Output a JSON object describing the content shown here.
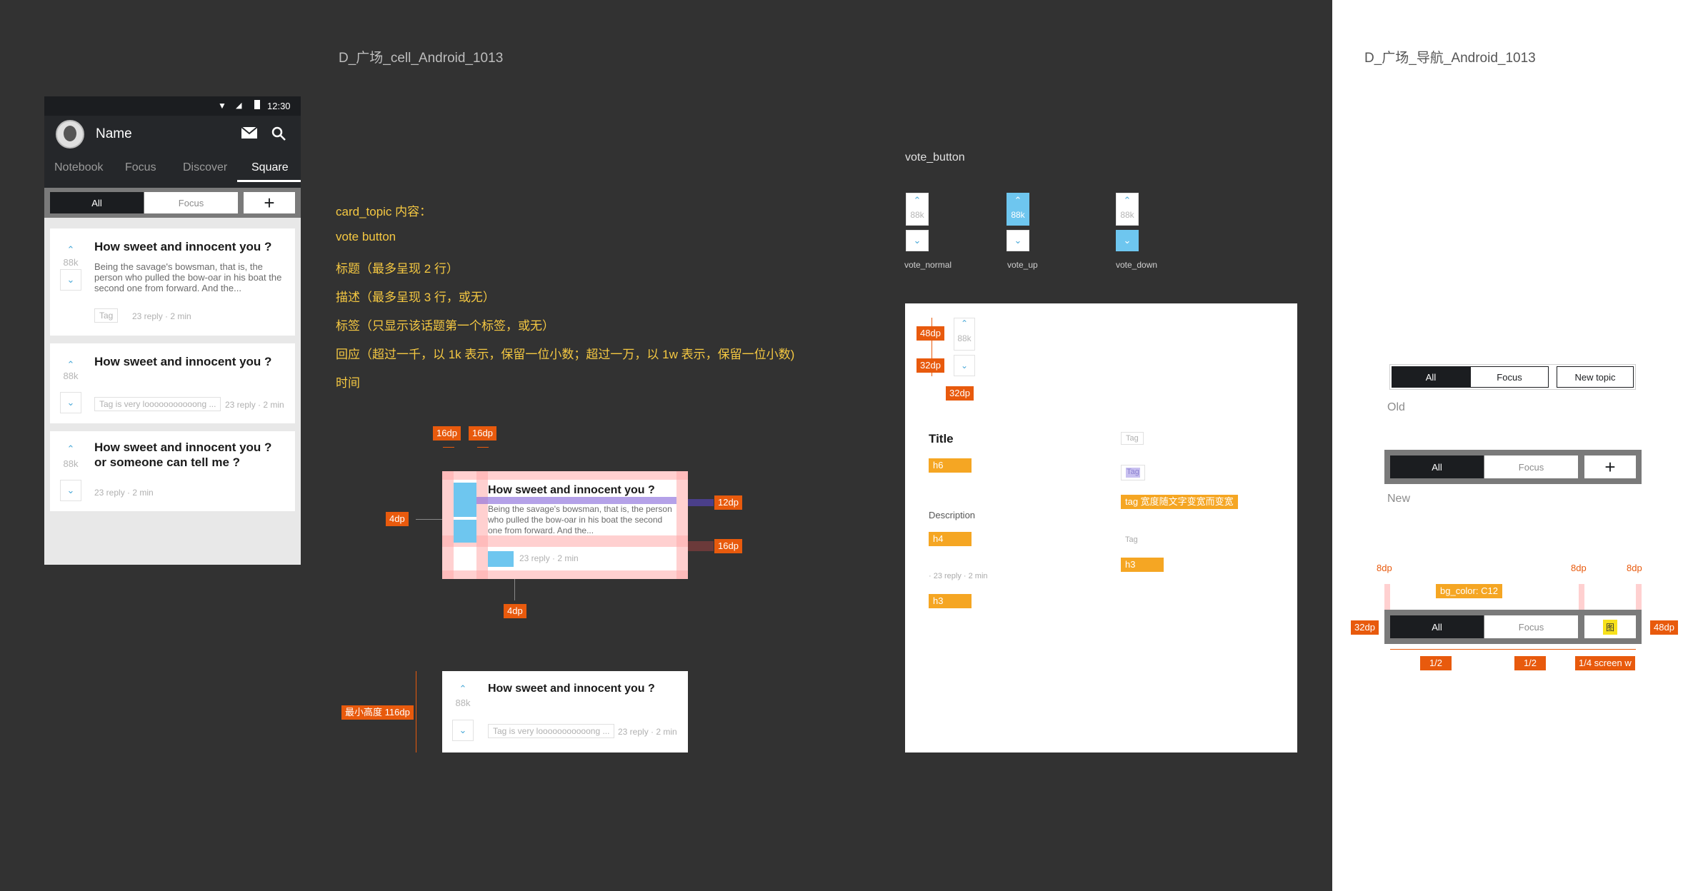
{
  "titles": {
    "cell": "D_广场_cell_Android_1013",
    "nav": "D_广场_导航_Android_1013"
  },
  "phone": {
    "status_time": "12:30",
    "app_name": "Name",
    "tabs": [
      "Notebook",
      "Focus",
      "Discover",
      "Square"
    ],
    "segment": [
      "All",
      "Focus"
    ],
    "add": "+",
    "cards": [
      {
        "count": "88k",
        "title": "How sweet and innocent you ?",
        "desc": "Being the savage's bowsman, that is, the person who pulled the bow-oar in his boat the second one from forward. And the...",
        "tag": "Tag",
        "meta": "23 reply · 2 min"
      },
      {
        "count": "88k",
        "title": "How sweet and innocent you ?",
        "tag": "Tag is very looooooooooong ...",
        "meta": "23 reply · 2 min"
      },
      {
        "count": "88k",
        "title": "How sweet and innocent you ?\nor someone can tell me ?",
        "meta": "23 reply · 2 min"
      }
    ]
  },
  "spec": {
    "lines": [
      "card_topic 内容：",
      "vote button",
      "标题（最多呈现 2 行）",
      "描述（最多呈现 3 行，或无）",
      "标签（只显示该话题第一个标签，或无）",
      "回应（超过一千，以 1k 表示，保留一位小数；超过一万，以 1w 表示，保留一位小数)",
      "时间"
    ]
  },
  "diagram": {
    "badges": [
      "16dp",
      "16dp",
      "12dp",
      "16dp",
      "4dp",
      "4dp"
    ],
    "card_title": "How sweet and innocent you ?",
    "card_desc": "Being the savage's bowsman, that is, the person who pulled the bow-oar in his boat the second one from forward. And the...",
    "card_meta": "23 reply · 2 min",
    "min_height": "最小高度 116dp",
    "card2_title": "How sweet and innocent you ?",
    "card2_count": "88k",
    "card2_tag": "Tag is very looooooooooong ...",
    "card2_meta": "23 reply · 2 min"
  },
  "vote_section": {
    "title": "vote_button",
    "states": [
      {
        "label": "vote_normal",
        "count": "88k"
      },
      {
        "label": "vote_up",
        "count": "88k"
      },
      {
        "label": "vote_down",
        "count": "88k"
      }
    ]
  },
  "typo_panel": {
    "badges": [
      "48dp",
      "32dp",
      "32dp"
    ],
    "count": "88k",
    "title": "Title",
    "h6": "h6",
    "description": "Description",
    "h4": "h4",
    "meta": "· 23 reply · 2 min",
    "h3a": "h3",
    "tag1": "Tag",
    "tag2": "Tag",
    "tag_note": "tag 宽度随文字变宽而变宽",
    "tag3": "Tag",
    "h3b": "h3"
  },
  "nav": {
    "old_tabs": [
      "All",
      "Focus",
      "New topic"
    ],
    "old_label": "Old",
    "new_tabs": [
      "All",
      "Focus"
    ],
    "new_add": "+",
    "new_label": "New",
    "spec_badges": [
      "8dp",
      "8dp",
      "8dp",
      "32dp",
      "48dp"
    ],
    "bg_color": "bg_color: C12",
    "spec_tabs": [
      "All",
      "Focus"
    ],
    "spec_icon": "图",
    "fractions": [
      "1/2",
      "1/2",
      "1/4 screen w"
    ]
  },
  "colors": {
    "accent": "#e85a0d",
    "label": "#f5a623",
    "blue": "#6ec6ef",
    "yellow_text": "#f5c842"
  }
}
